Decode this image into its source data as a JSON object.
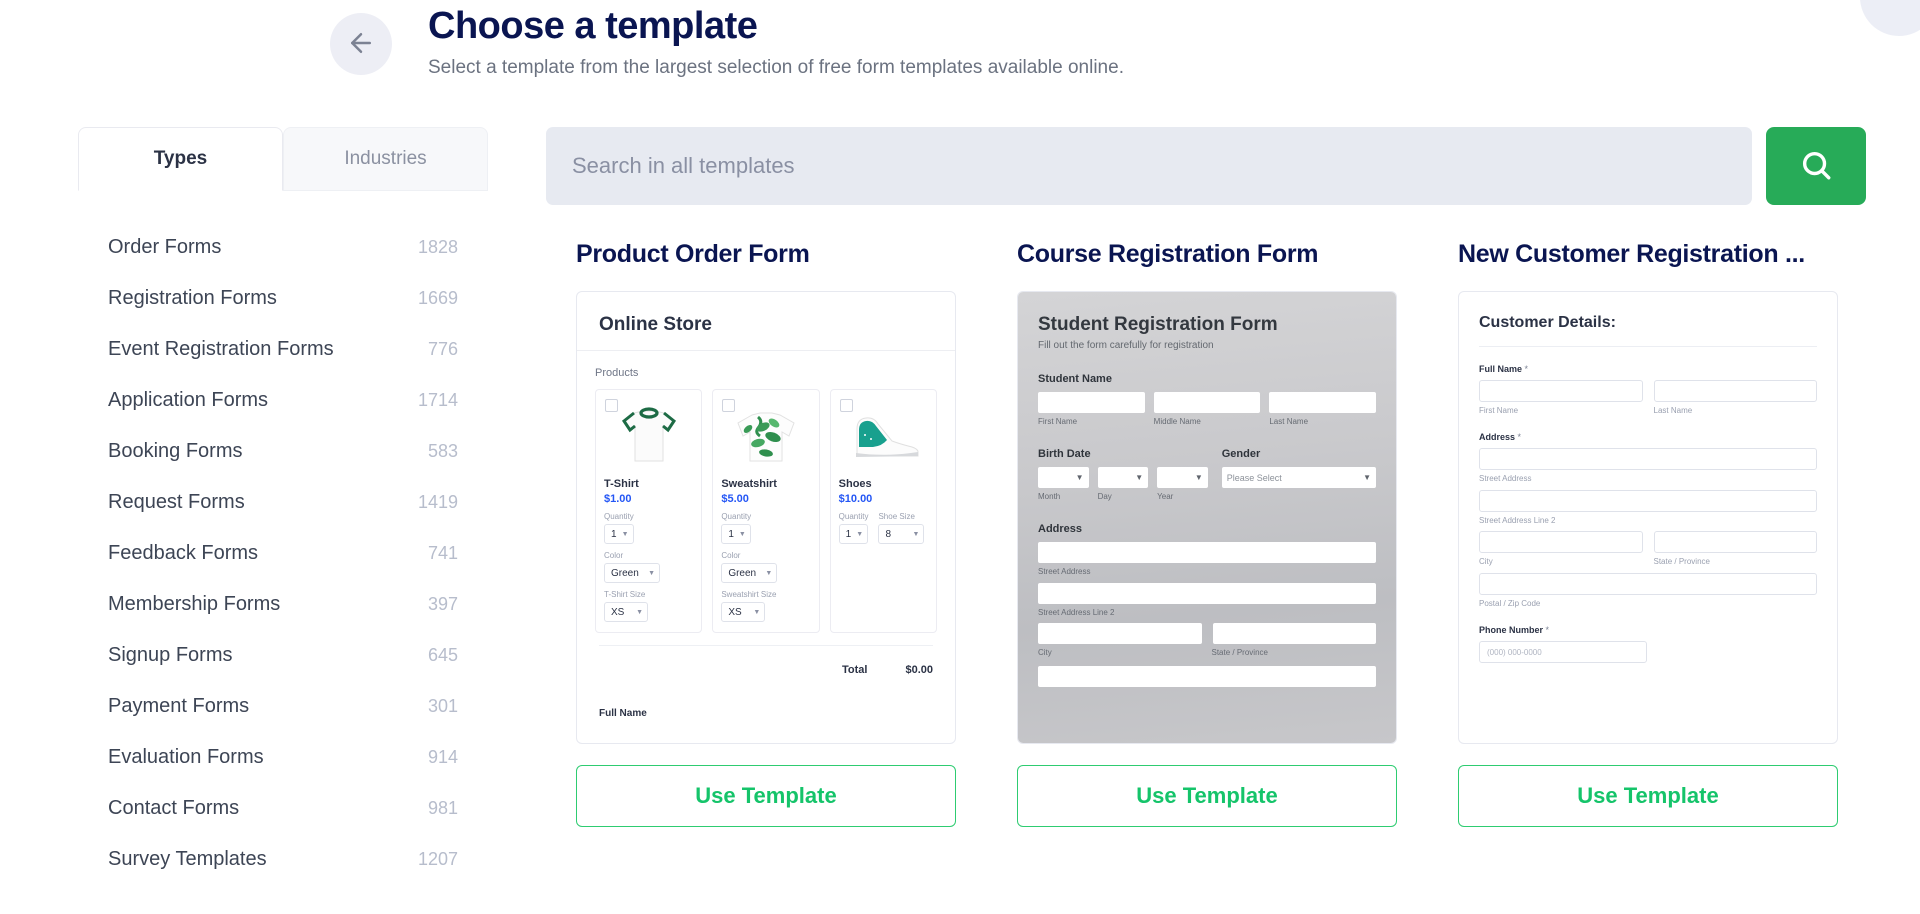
{
  "header": {
    "back_icon": "arrow-left-icon",
    "title": "Choose a template",
    "subtitle": "Select a template from the largest selection of free form templates available online."
  },
  "sidebar": {
    "tabs": [
      {
        "label": "Types",
        "active": true
      },
      {
        "label": "Industries",
        "active": false
      }
    ],
    "categories": [
      {
        "label": "Order Forms",
        "count": "1828"
      },
      {
        "label": "Registration Forms",
        "count": "1669"
      },
      {
        "label": "Event Registration Forms",
        "count": "776"
      },
      {
        "label": "Application Forms",
        "count": "1714"
      },
      {
        "label": "Booking Forms",
        "count": "583"
      },
      {
        "label": "Request Forms",
        "count": "1419"
      },
      {
        "label": "Feedback Forms",
        "count": "741"
      },
      {
        "label": "Membership Forms",
        "count": "397"
      },
      {
        "label": "Signup Forms",
        "count": "645"
      },
      {
        "label": "Payment Forms",
        "count": "301"
      },
      {
        "label": "Evaluation Forms",
        "count": "914"
      },
      {
        "label": "Contact Forms",
        "count": "981"
      },
      {
        "label": "Survey Templates",
        "count": "1207"
      }
    ]
  },
  "search": {
    "value": "",
    "placeholder": "Search in all templates",
    "button_icon": "search-icon"
  },
  "colors": {
    "accent_green": "#27ab58",
    "button_green": "#15c46a",
    "title_navy": "#0a1551",
    "price_blue": "#2456f5"
  },
  "cards": [
    {
      "title": "Product Order Form",
      "use_label": "Use Template",
      "preview": {
        "heading": "Online Store",
        "section_label": "Products",
        "total_label": "Total",
        "total_value": "$0.00",
        "footer_label": "Full Name",
        "products": [
          {
            "name": "T-Shirt",
            "price": "$1.00",
            "image": "tshirt-image",
            "quantity_label": "Quantity",
            "quantity_value": "1",
            "color_label": "Color",
            "color_value": "Green",
            "size_label": "T-Shirt Size",
            "size_value": "XS"
          },
          {
            "name": "Sweatshirt",
            "price": "$5.00",
            "image": "sweatshirt-image",
            "quantity_label": "Quantity",
            "quantity_value": "1",
            "color_label": "Color",
            "color_value": "Green",
            "size_label": "Sweatshirt Size",
            "size_value": "XS"
          },
          {
            "name": "Shoes",
            "price": "$10.00",
            "image": "shoe-image",
            "quantity_label": "Quantity",
            "quantity_value": "1",
            "size_label": "Shoe Size",
            "size_value": "8"
          }
        ]
      }
    },
    {
      "title": "Course Registration Form",
      "use_label": "Use Template",
      "preview": {
        "heading": "Student Registration Form",
        "subheading": "Fill out the form carefully for registration",
        "student_name_label": "Student Name",
        "first_name": "First Name",
        "middle_name": "Middle Name",
        "last_name": "Last Name",
        "birth_date_label": "Birth Date",
        "month": "Month",
        "day": "Day",
        "year": "Year",
        "gender_label": "Gender",
        "gender_placeholder": "Please Select",
        "address_label": "Address",
        "street_address": "Street Address",
        "street_address_2": "Street Address Line 2",
        "city": "City",
        "state": "State / Province"
      }
    },
    {
      "title": "New Customer Registration ...",
      "use_label": "Use Template",
      "preview": {
        "heading": "Customer Details:",
        "full_name_label": "Full Name",
        "required_mark": "*",
        "first_name": "First Name",
        "last_name": "Last Name",
        "address_label": "Address",
        "street_address": "Street Address",
        "street_address_2": "Street Address Line 2",
        "city": "City",
        "state": "State / Province",
        "postal": "Postal / Zip Code",
        "phone_label": "Phone Number",
        "phone_placeholder": "(000) 000-0000"
      }
    }
  ]
}
